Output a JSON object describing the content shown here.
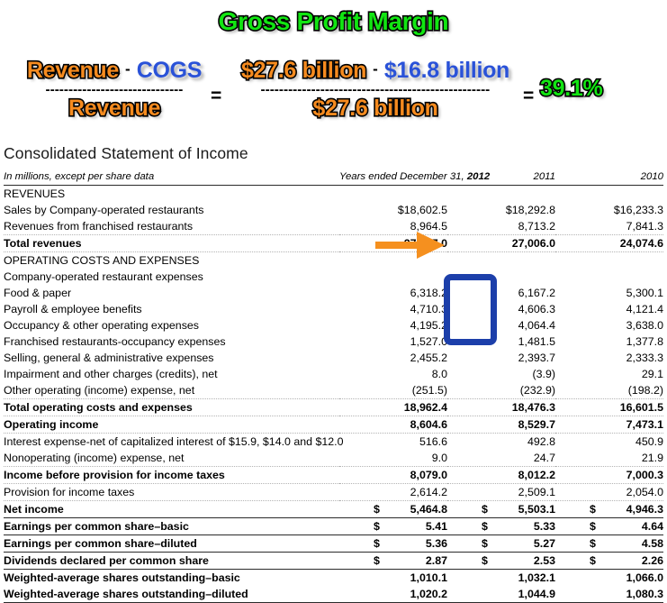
{
  "formula": {
    "title": "Gross Profit Margin",
    "left": {
      "numerator_first": "Revenue",
      "operator": "-",
      "numerator_second": "COGS",
      "denominator": "Revenue"
    },
    "equals_1": "=",
    "right": {
      "numerator_first": "$27.6 billion",
      "operator": "-",
      "numerator_second": "$16.8 billion",
      "denominator": "$27.6 billion"
    },
    "equals_2": "=",
    "result": "39.1%",
    "bar_dashes": "------------------------------",
    "bar_dashes_long": "--------------------------------------------------",
    "colors": {
      "revenue_orange": "#f68b1f",
      "cogs_blue": "#2a52d8",
      "result_green": "#12e512",
      "title_green": "#12e512"
    }
  },
  "statement": {
    "title": "Consolidated Statement of Income",
    "header": {
      "units_note": "In millions, except per share data",
      "col_1_prefix": "Years ended December 31, ",
      "col_1_year": "2012",
      "col_2": "2011",
      "col_3": "2010"
    },
    "rows": [
      {
        "label": "REVENUES",
        "indent": 0,
        "bold": false,
        "v1": "",
        "v2": "",
        "v3": "",
        "sep": "none"
      },
      {
        "label": "Sales by Company-operated restaurants",
        "indent": 0,
        "bold": false,
        "v1": "$18,602.5",
        "v2": "$18,292.8",
        "v3": "$16,233.3",
        "sep": "none"
      },
      {
        "label": "Revenues from franchised restaurants",
        "indent": 0,
        "bold": false,
        "v1": "8,964.5",
        "v2": "8,713.2",
        "v3": "7,841.3",
        "sep": "dotted"
      },
      {
        "label": "Total revenues",
        "indent": 1,
        "bold": true,
        "v1": "27,567.0",
        "v2": "27,006.0",
        "v3": "24,074.6",
        "sep": "dotted"
      },
      {
        "label": "OPERATING COSTS AND EXPENSES",
        "indent": 0,
        "bold": false,
        "v1": "",
        "v2": "",
        "v3": "",
        "sep": "none"
      },
      {
        "label": "Company-operated restaurant expenses",
        "indent": 0,
        "bold": false,
        "v1": "",
        "v2": "",
        "v3": "",
        "sep": "none"
      },
      {
        "label": "Food & paper",
        "indent": 2,
        "bold": false,
        "v1": "6,318.2",
        "v2": "6,167.2",
        "v3": "5,300.1",
        "sep": "none"
      },
      {
        "label": "Payroll & employee benefits",
        "indent": 2,
        "bold": false,
        "v1": "4,710.3",
        "v2": "4,606.3",
        "v3": "4,121.4",
        "sep": "none"
      },
      {
        "label": "Occupancy & other operating expenses",
        "indent": 2,
        "bold": false,
        "v1": "4,195.2",
        "v2": "4,064.4",
        "v3": "3,638.0",
        "sep": "none"
      },
      {
        "label": "Franchised restaurants-occupancy expenses",
        "indent": 0,
        "bold": false,
        "v1": "1,527.0",
        "v2": "1,481.5",
        "v3": "1,377.8",
        "sep": "none"
      },
      {
        "label": "Selling, general & administrative expenses",
        "indent": 0,
        "bold": false,
        "v1": "2,455.2",
        "v2": "2,393.7",
        "v3": "2,333.3",
        "sep": "none"
      },
      {
        "label": "Impairment and other charges (credits), net",
        "indent": 0,
        "bold": false,
        "v1": "8.0",
        "v2": "(3.9)",
        "v3": "29.1",
        "sep": "none"
      },
      {
        "label": "Other operating (income) expense, net",
        "indent": 0,
        "bold": false,
        "v1": "(251.5)",
        "v2": "(232.9)",
        "v3": "(198.2)",
        "sep": "dotted"
      },
      {
        "label": "Total operating costs and expenses",
        "indent": 1,
        "bold": true,
        "v1": "18,962.4",
        "v2": "18,476.3",
        "v3": "16,601.5",
        "sep": "dotted"
      },
      {
        "label": "Operating income",
        "indent": 0,
        "bold": true,
        "v1": "8,604.6",
        "v2": "8,529.7",
        "v3": "7,473.1",
        "sep": "dotted"
      },
      {
        "label": "Interest expense-net of capitalized interest of $15.9, $14.0 and $12.0",
        "indent": 0,
        "bold": false,
        "v1": "516.6",
        "v2": "492.8",
        "v3": "450.9",
        "sep": "none"
      },
      {
        "label": "Nonoperating (income) expense, net",
        "indent": 0,
        "bold": false,
        "v1": "9.0",
        "v2": "24.7",
        "v3": "21.9",
        "sep": "dotted"
      },
      {
        "label": "Income before provision for income taxes",
        "indent": 0,
        "bold": true,
        "v1": "8,079.0",
        "v2": "8,012.2",
        "v3": "7,000.3",
        "sep": "dotted"
      },
      {
        "label": "Provision for income taxes",
        "indent": 0,
        "bold": false,
        "v1": "2,614.2",
        "v2": "2,509.1",
        "v3": "2,054.0",
        "sep": "dotted"
      },
      {
        "label": "Net income",
        "indent": 0,
        "bold": true,
        "v1": "5,464.8",
        "v2": "5,503.1",
        "v3": "4,946.3",
        "d1": "$",
        "d2": "$",
        "d3": "$",
        "sep": "solid"
      },
      {
        "label": "Earnings per common share–basic",
        "indent": 0,
        "bold": true,
        "v1": "5.41",
        "v2": "5.33",
        "v3": "4.64",
        "d1": "$",
        "d2": "$",
        "d3": "$",
        "sep": "solid"
      },
      {
        "label": "Earnings per common share–diluted",
        "indent": 0,
        "bold": true,
        "v1": "5.36",
        "v2": "5.27",
        "v3": "4.58",
        "d1": "$",
        "d2": "$",
        "d3": "$",
        "sep": "solid"
      },
      {
        "label": "Dividends declared per common share",
        "indent": 0,
        "bold": true,
        "v1": "2.87",
        "v2": "2.53",
        "v3": "2.26",
        "d1": "$",
        "d2": "$",
        "d3": "$",
        "sep": "solid"
      },
      {
        "label": "Weighted-average shares outstanding–basic",
        "indent": 0,
        "bold": true,
        "v1": "1,010.1",
        "v2": "1,032.1",
        "v3": "1,066.0",
        "sep": "none"
      },
      {
        "label": "Weighted-average shares outstanding–diluted",
        "indent": 0,
        "bold": true,
        "v1": "1,020.2",
        "v2": "1,044.9",
        "v3": "1,080.3",
        "sep": "solid"
      }
    ]
  },
  "annotations": {
    "highlight_box": {
      "name": "blue-highlight-box",
      "color": "#1c3faa",
      "covers_rows": [
        "Food & paper",
        "Payroll & employee benefits",
        "Occupancy & other operating expenses",
        "Franchised restaurants-occupancy expenses"
      ]
    },
    "arrow": {
      "name": "orange-arrow",
      "color": "#f5901f",
      "points_at": "Total revenues 27,567.0"
    }
  }
}
